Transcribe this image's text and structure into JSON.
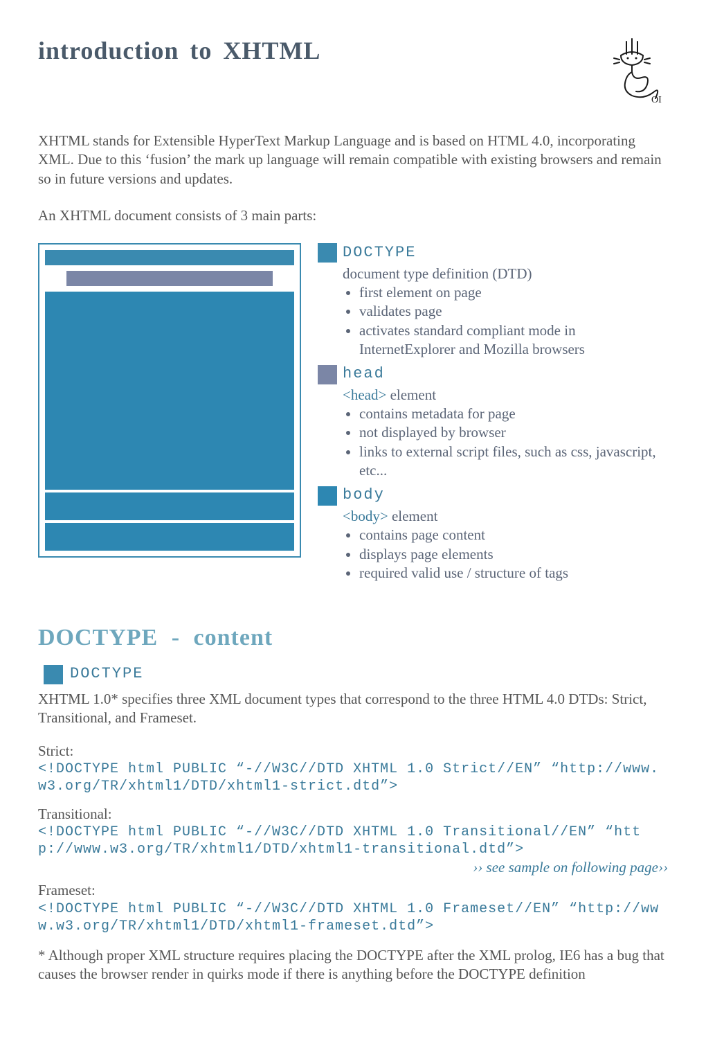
{
  "title_part1": "introduction  to  ",
  "title_part2": "XHTML",
  "intro": "XHTML stands for Extensible HyperText Markup Language and is based on HTML 4.0, incorporating XML. Due to this ‘fusion’ the mark up language will remain compatible with existing browsers and remain so in future versions and updates.",
  "subintro": "An XHTML document consists of 3 main parts:",
  "parts": {
    "doctype": {
      "label": "DOCTYPE",
      "desc": "document type definition  (DTD)",
      "bullets": [
        "first element on page",
        "validates page",
        "activates standard compliant mode in InternetExplorer and Mozilla browsers"
      ]
    },
    "head": {
      "label": "head",
      "tag": "<head>",
      "desc_suffix": " element",
      "bullets": [
        "contains metadata for page",
        "not displayed by browser",
        "links to external script files, such as css, javascript, etc..."
      ]
    },
    "body": {
      "label": "body",
      "tag": "<body>",
      "desc_suffix": " element",
      "bullets": [
        "contains page content",
        "displays page elements",
        "required valid use / structure  of tags"
      ]
    }
  },
  "section2": {
    "title": "DOCTYPE  -  content",
    "label": "DOCTYPE",
    "intro": "XHTML 1.0* specifies three XML document types that correspond to the three HTML 4.0 DTDs: Strict, Transitional, and Frameset.",
    "strict_label": "Strict:",
    "strict_code": "<!DOCTYPE html PUBLIC “-//W3C//DTD XHTML 1.0 Strict//EN” “http://www.w3.org/TR/xhtml1/DTD/xhtml1-strict.dtd”>",
    "transitional_label": "Transitional:",
    "transitional_code": "<!DOCTYPE html PUBLIC “-//W3C//DTD XHTML 1.0 Transitional//EN” “http://www.w3.org/TR/xhtml1/DTD/xhtml1-transitional.dtd”>",
    "see_sample": "›› see sample on following page››",
    "frameset_label": "Frameset:",
    "frameset_code": "<!DOCTYPE html PUBLIC “-//W3C//DTD XHTML 1.0 Frameset//EN” “http://www.w3.org/TR/xhtml1/DTD/xhtml1-frameset.dtd”>",
    "footnote": "* Although proper XML structure requires placing the DOCTYPE after the XML prolog, IE6 has a bug that causes the browser render in quirks mode if there is anything before the DOCTYPE definition"
  }
}
